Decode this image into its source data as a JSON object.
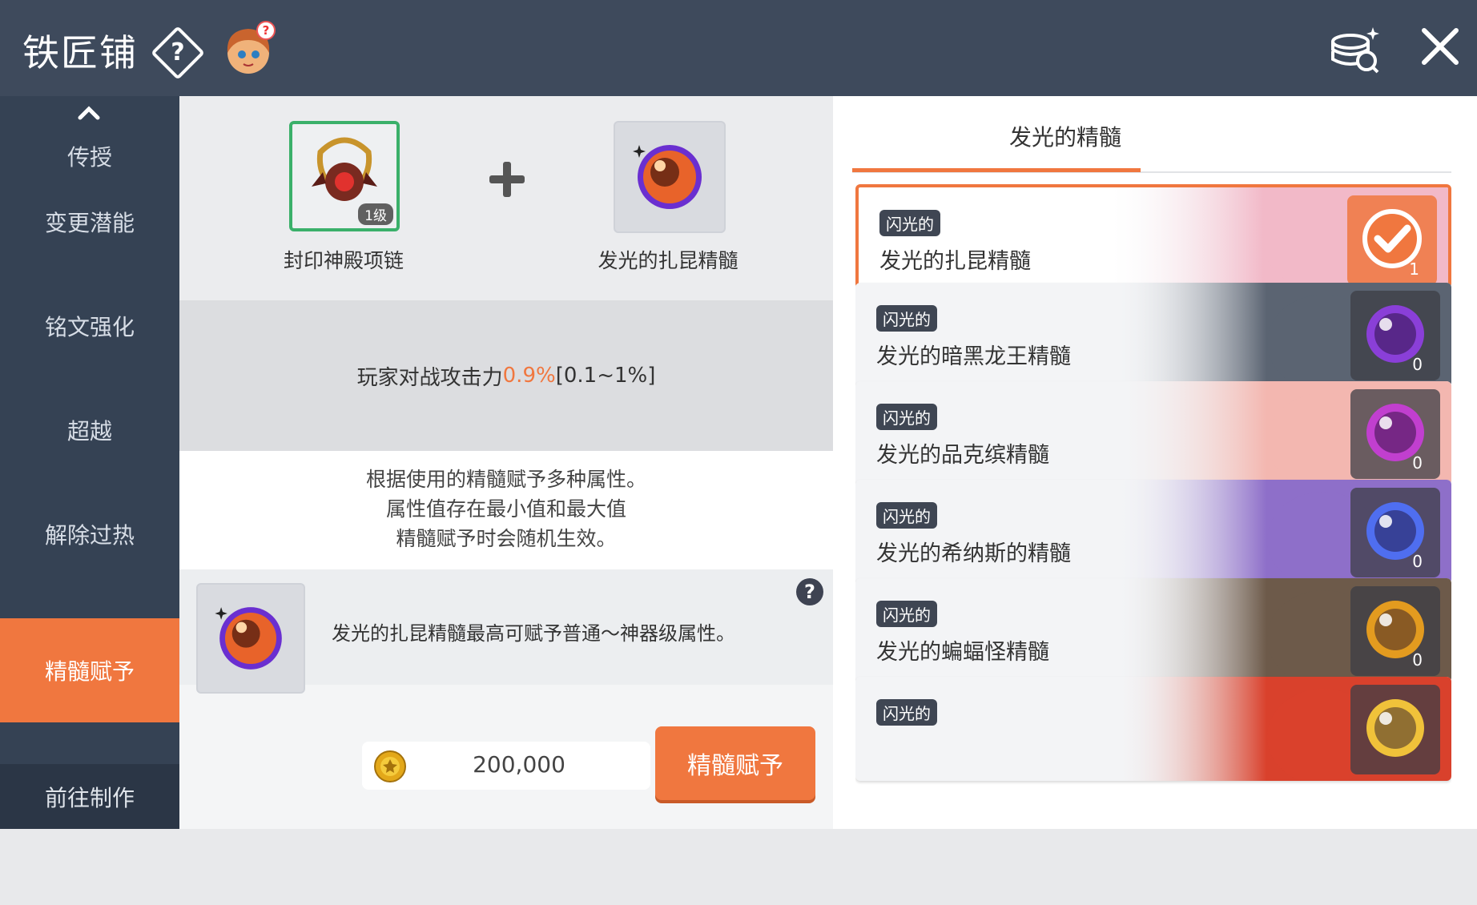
{
  "header": {
    "title": "铁匠铺",
    "help_icon": "?",
    "npc_icon": "npc-avatar-icon",
    "coin_exchange_icon": "coin-exchange-icon",
    "close_icon": "close-icon"
  },
  "sidebar": {
    "items": [
      {
        "label": "传授"
      },
      {
        "label": "变更潜能"
      },
      {
        "label": "铭文强化"
      },
      {
        "label": "超越"
      },
      {
        "label": "解除过热"
      },
      {
        "label": "精髓赋予"
      }
    ],
    "active_index": 5,
    "goto_label": "前往制作"
  },
  "center": {
    "equip": {
      "name": "封印神殿项链",
      "level": "1级"
    },
    "essence": {
      "name": "发光的扎昆精髓"
    },
    "stat": {
      "label": "玩家对战攻击力",
      "value": "0.9%",
      "range": "[0.1~1%]"
    },
    "description": [
      "根据使用的精髓赋予多种属性。",
      "属性值存在最小值和最大值",
      "精髓赋予时会随机生效。"
    ],
    "info_text": "发光的扎昆精髓最高可赋予普通～神器级属性。",
    "info_help": "?",
    "cost": "200,000",
    "apply_label": "精髓赋予"
  },
  "right": {
    "tab_title": "发光的精髓",
    "cards": [
      {
        "badge": "闪光的",
        "name": "发光的扎昆精髓",
        "count": "1",
        "selected": true,
        "orb": "#e8632a",
        "art": "#f2b9c8"
      },
      {
        "badge": "闪光的",
        "name": "发光的暗黑龙王精髓",
        "count": "0",
        "selected": false,
        "orb": "#8a3fd8",
        "art": "#5b6472"
      },
      {
        "badge": "闪光的",
        "name": "发光的品克缤精髓",
        "count": "0",
        "selected": false,
        "orb": "#c13fcf",
        "art": "#f3b7b0"
      },
      {
        "badge": "闪光的",
        "name": "发光的希纳斯的精髓",
        "count": "0",
        "selected": false,
        "orb": "#4f6ef0",
        "art": "#8e6fc9"
      },
      {
        "badge": "闪光的",
        "name": "发光的蝙蝠怪精髓",
        "count": "0",
        "selected": false,
        "orb": "#e39b1f",
        "art": "#6d5a4a"
      },
      {
        "badge": "闪光的",
        "name": "",
        "count": "",
        "selected": false,
        "orb": "#f0c23a",
        "art": "#d9412c"
      }
    ]
  },
  "colors": {
    "accent": "#f0773f",
    "header": "#3e4a5c",
    "sidebar": "#354254"
  }
}
